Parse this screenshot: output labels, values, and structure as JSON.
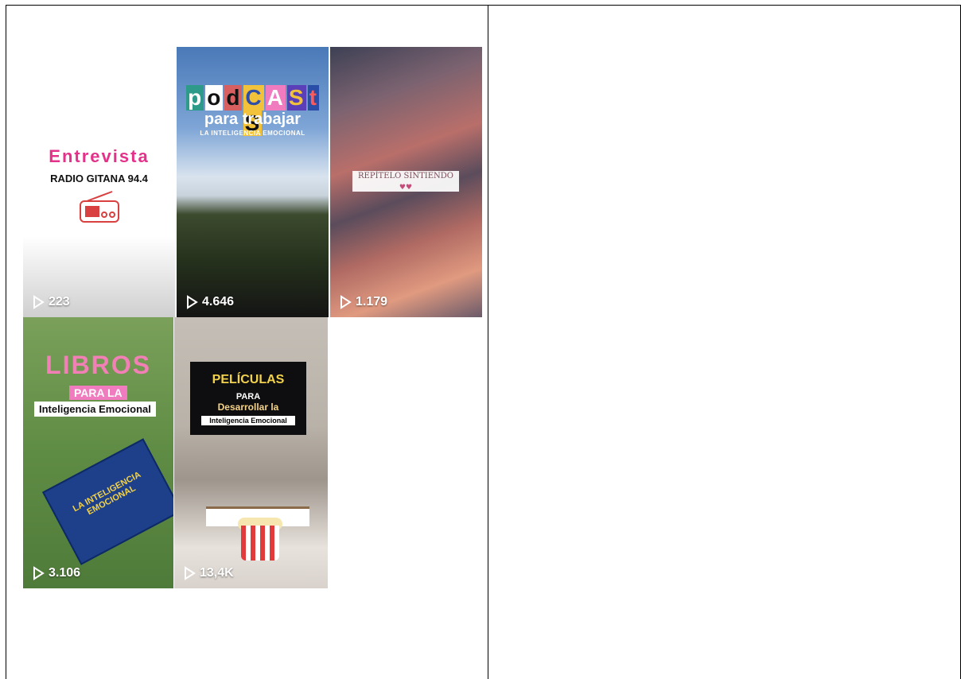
{
  "tiles": [
    {
      "id": "entrevista",
      "title": "Entrevista",
      "subtitle": "RADIO GITANA 94.4",
      "views": "223",
      "icon": "radio-icon"
    },
    {
      "id": "podcasts",
      "title_letters": [
        "p",
        "o",
        "d",
        "C",
        "A",
        "S",
        "t",
        "S"
      ],
      "line2": "para trabajar",
      "line3": "LA INTELIGENCIA EMOCIONAL",
      "views": "4.646"
    },
    {
      "id": "repitelo",
      "caption": "REPÍTELO SINTIENDO",
      "views": "1.179"
    },
    {
      "id": "libros",
      "title": "LIBROS",
      "line2": "PARA LA",
      "line3": "Inteligencia Emocional",
      "book_text": "LA INTELIGENCIA EMOCIONAL",
      "views": "3.106"
    },
    {
      "id": "peliculas",
      "title": "PELÍCULAS",
      "line2": "PARA",
      "line3": "Desarrollar la",
      "line4": "Inteligencia Emocional",
      "views": "13,4K"
    }
  ],
  "colors": {
    "accent_pink": "#f07cbf",
    "play_icon": "#ffffff"
  }
}
